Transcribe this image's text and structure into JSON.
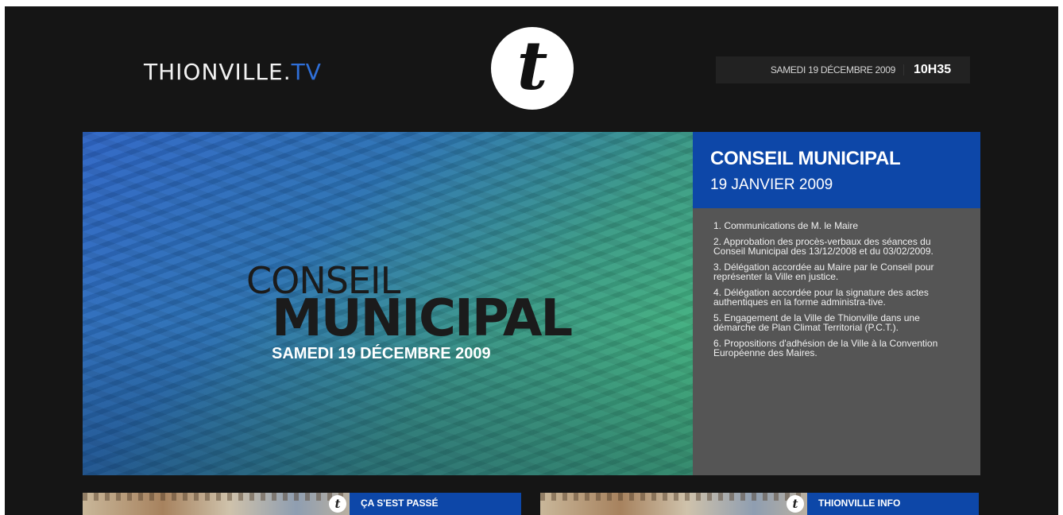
{
  "header": {
    "brand_main": "THIONVILLE.",
    "brand_suffix": "TV",
    "logo_letter": "t",
    "date": "SAMEDI 19 DÉCEMBRE 2009",
    "time": "10H35"
  },
  "hero": {
    "title_line1": "CONSEIL",
    "title_line2": "MUNICIPAL",
    "subtitle": "SAMEDI 19 DÉCEMBRE 2009"
  },
  "agenda": {
    "title": "CONSEIL MUNICIPAL",
    "date": "19 JANVIER 2009",
    "items": [
      "1. Communications de M. le Maire",
      "2. Approbation des procès-verbaux des séances du Conseil Municipal des 13/12/2008 et du 03/02/2009.",
      "3. Délégation accordée au Maire par le Conseil pour représenter la Ville en justice.",
      "4. Délégation accordée pour la signature des actes authentiques en la forme administra-tive.",
      "5. Engagement de la Ville de Thionville dans une démarche de Plan Climat Territorial (P.C.T.).",
      "6. Propositions d'adhésion de la Ville à la Convention Européenne des Maires."
    ]
  },
  "strips": [
    {
      "label": "ÇA S'EST PASSÉ",
      "badge": "t"
    },
    {
      "label": "THIONVILLE INFO",
      "badge": "t"
    }
  ],
  "colors": {
    "background": "#151515",
    "accent_blue": "#0d47a8",
    "agenda_gray": "#555555",
    "brand_tv": "#2f6fd8"
  }
}
